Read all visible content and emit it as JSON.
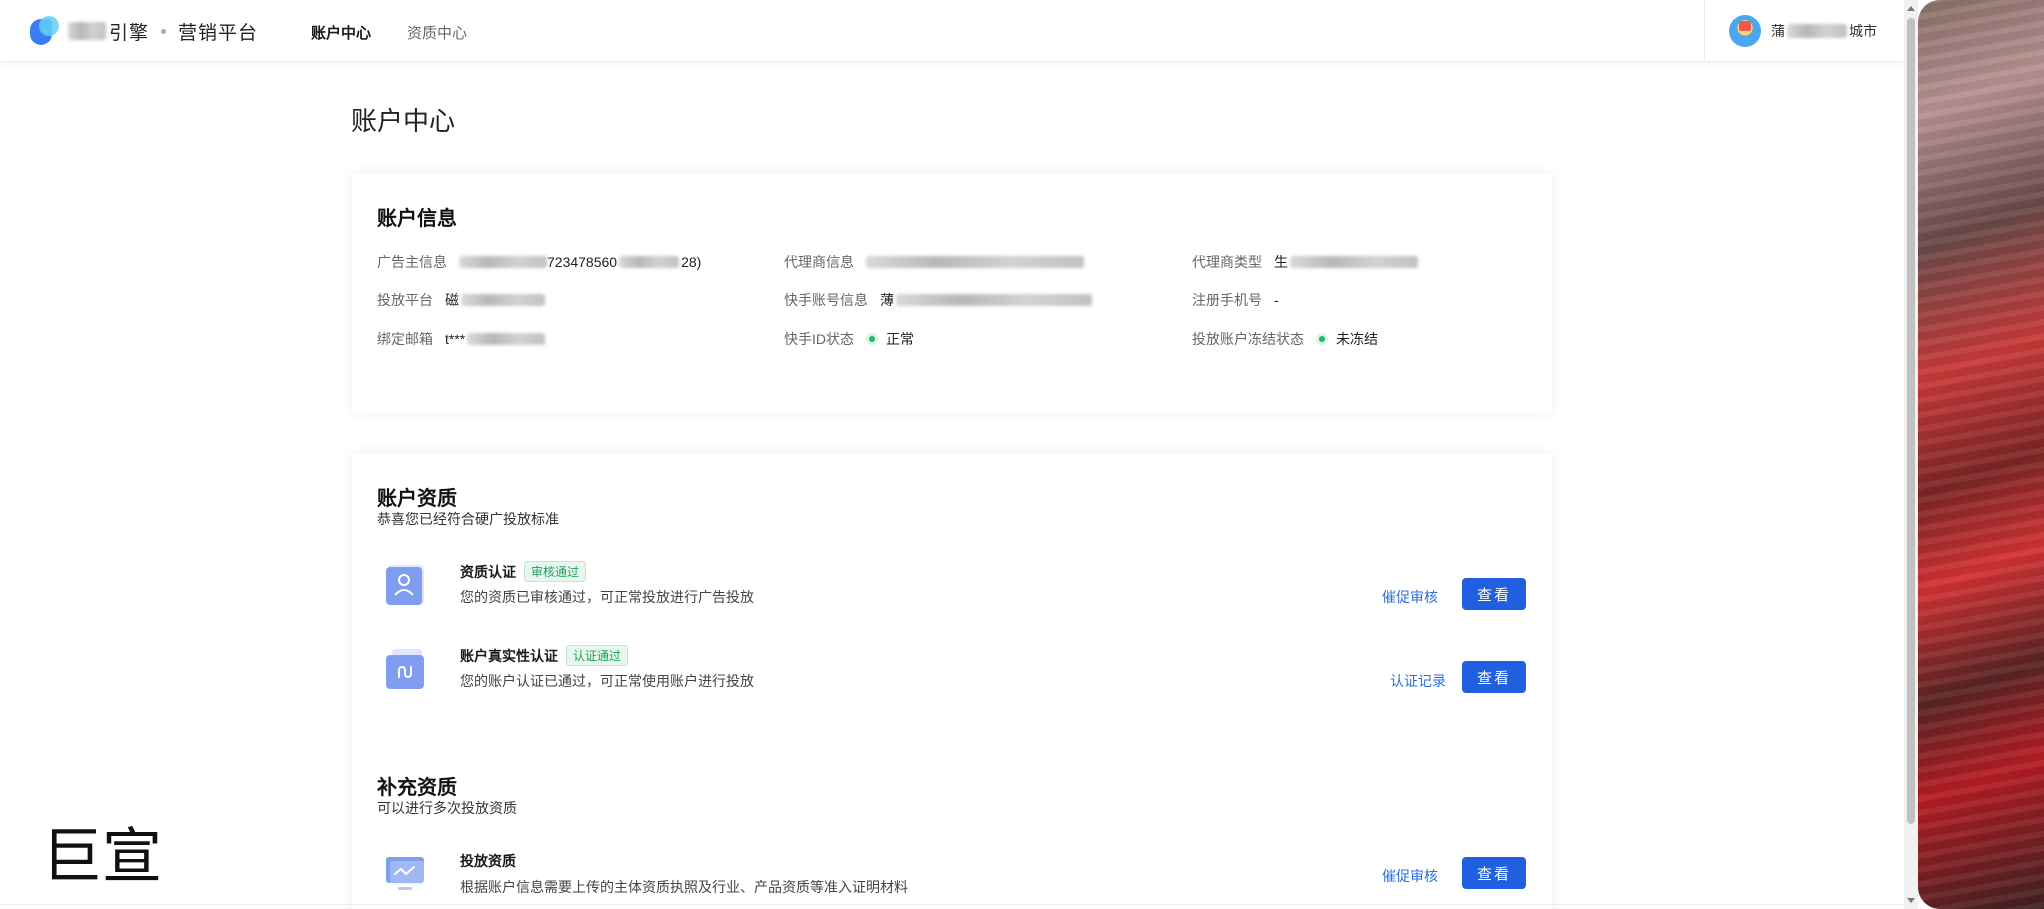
{
  "header": {
    "brand_suffix": "引擎",
    "platform_name": "营销平台",
    "nav": [
      "账户中心",
      "资质中心"
    ],
    "user_name_suffix": "城市"
  },
  "page_title": "账户中心",
  "account_info": {
    "title": "账户信息",
    "fields": [
      {
        "label": "广告主信息",
        "value_prefix": "",
        "value_visible": "723478560",
        "value_suffix": "28)"
      },
      {
        "label": "代理商信息",
        "value_visible": ""
      },
      {
        "label": "代理商类型",
        "value_prefix": "生"
      },
      {
        "label": "投放平台",
        "value_prefix": "磁"
      },
      {
        "label": "快手账号信息",
        "value_prefix": "薄"
      },
      {
        "label": "注册手机号",
        "value": "-"
      },
      {
        "label": "绑定邮箱",
        "value_prefix": "t***"
      },
      {
        "label": "快手ID状态",
        "value": "正常",
        "status_color": "#22b870"
      },
      {
        "label": "投放账户冻结状态",
        "value": "未冻结",
        "status_color": "#22b870"
      }
    ]
  },
  "account_qualification": {
    "title": "账户资质",
    "subtitle": "恭喜您已经符合硬广投放标准",
    "items": [
      {
        "title": "资质认证",
        "tag": "审核通过",
        "desc": "您的资质已审核通过，可正常投放进行广告投放",
        "link": "催促审核",
        "button": "查看",
        "icon": "user-card-icon"
      },
      {
        "title": "账户真实性认证",
        "tag": "认证通过",
        "desc": "您的账户认证已通过，可正常使用账户进行投放",
        "link": "认证记录",
        "button": "查看",
        "icon": "folder-link-icon"
      }
    ]
  },
  "supplementary_qualification": {
    "title": "补充资质",
    "subtitle": "可以进行多次投放资质",
    "items": [
      {
        "title": "投放资质",
        "desc": "根据账户信息需要上传的主体资质执照及行业、产品资质等准入证明材料",
        "link": "催促审核",
        "button": "查看",
        "icon": "monitor-chart-icon"
      }
    ]
  },
  "watermark": "巨宣",
  "colors": {
    "primary": "#1f5fe0",
    "link": "#2e6fdc",
    "success": "#22b870",
    "tag_bg": "#e8f7ee"
  }
}
